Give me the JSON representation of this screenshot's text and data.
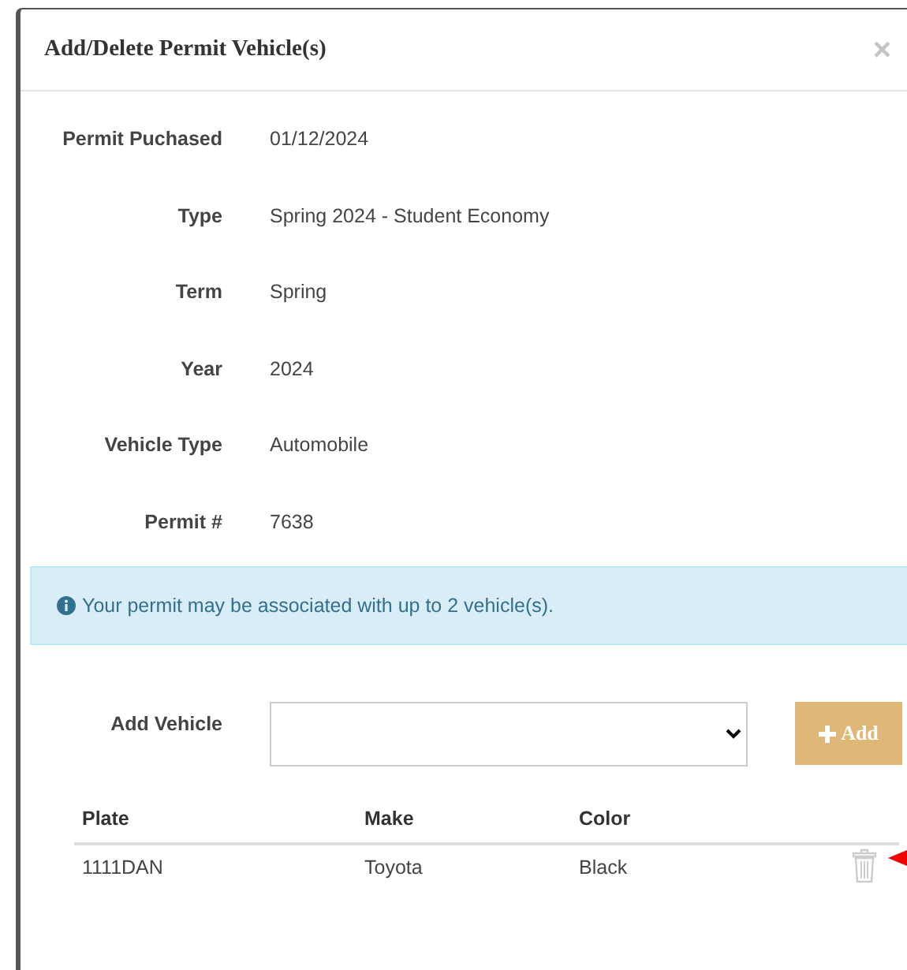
{
  "modal": {
    "title": "Add/Delete Permit Vehicle(s)",
    "close": "×"
  },
  "details": [
    {
      "label": "Permit Puchased",
      "value": "01/12/2024"
    },
    {
      "label": "Type",
      "value": "Spring 2024 - Student Economy"
    },
    {
      "label": "Term",
      "value": "Spring"
    },
    {
      "label": "Year",
      "value": "2024"
    },
    {
      "label": "Vehicle Type",
      "value": "Automobile"
    },
    {
      "label": "Permit #",
      "value": "7638"
    }
  ],
  "alert": {
    "text": "Your permit may be associated with up to 2 vehicle(s)."
  },
  "add_vehicle": {
    "label": "Add Vehicle",
    "button": "Add"
  },
  "table": {
    "columns": [
      "Plate",
      "Make",
      "Color"
    ],
    "rows": [
      {
        "cells": [
          "1111DAN",
          "Toyota",
          "Black"
        ]
      }
    ]
  }
}
